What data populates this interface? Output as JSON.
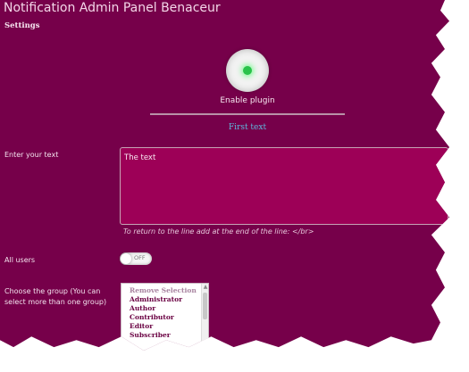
{
  "window": {
    "title": "Notification Admin Panel Benaceur"
  },
  "section": {
    "settings": "Settings"
  },
  "plugin": {
    "label": "Enable plugin"
  },
  "first_text": {
    "label": "First text"
  },
  "text_field": {
    "label": "Enter your text",
    "value": "The text",
    "hint": "To return to the line add at the end of the line: </br>"
  },
  "all_users": {
    "label": "All users",
    "toggle_state": "OFF"
  },
  "group": {
    "label": "Choose the group (You can select more than one group)",
    "options": [
      "Remove Selection",
      "Administrator",
      "Author",
      "Contributor",
      "Editor",
      "Subscriber"
    ]
  },
  "colors": {
    "panel_bg": "#76004a",
    "textarea_bg": "#9d0057",
    "indicator_on": "#29c24a",
    "link": "#5fb7dd"
  }
}
